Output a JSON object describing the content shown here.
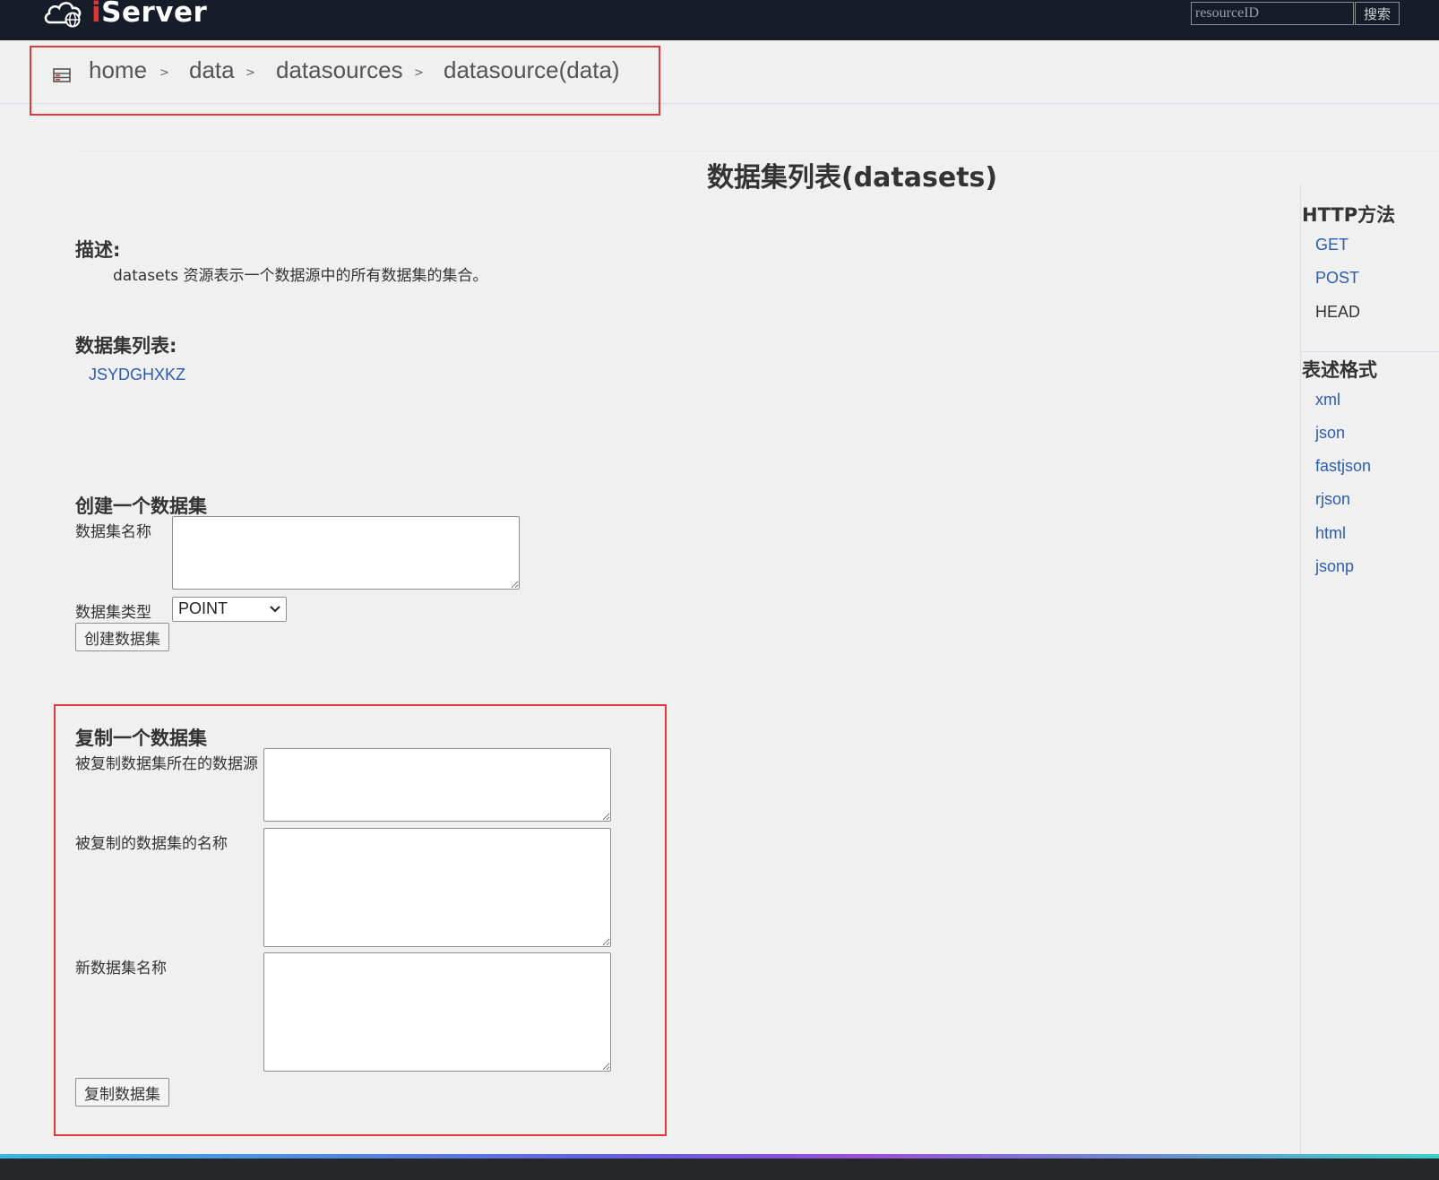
{
  "header": {
    "logo_prefix": "i",
    "logo_suffix": "Server",
    "search_placeholder": "resourceID",
    "search_button": "搜索"
  },
  "breadcrumb": [
    {
      "label": "home"
    },
    {
      "label": "data"
    },
    {
      "label": "datasources"
    },
    {
      "label": "datasource(data)"
    }
  ],
  "breadcrumb_separator": ">",
  "main": {
    "title": "数据集列表(datasets)",
    "description_heading": "描述:",
    "description_text": "datasets 资源表示一个数据源中的所有数据集的集合。",
    "list_heading": "数据集列表:",
    "datasets": [
      "JSYDGHXKZ"
    ],
    "create": {
      "heading": "创建一个数据集",
      "name_label": "数据集名称",
      "type_label": "数据集类型",
      "type_selected": "POINT",
      "submit": "创建数据集"
    },
    "copy": {
      "heading": "复制一个数据集",
      "source_datasource_label": "被复制数据集所在的数据源",
      "source_dataset_label": "被复制的数据集的名称",
      "new_name_label": "新数据集名称",
      "submit": "复制数据集"
    }
  },
  "sidebar": {
    "http_heading": "HTTP方法",
    "http_methods": [
      {
        "label": "GET",
        "link": true
      },
      {
        "label": "POST",
        "link": true
      },
      {
        "label": "HEAD",
        "link": false
      }
    ],
    "format_heading": "表述格式",
    "formats": [
      "xml",
      "json",
      "fastjson",
      "rjson",
      "html",
      "jsonp"
    ]
  },
  "colors": {
    "topbar": "#161d29",
    "highlight_border": "#e2383a",
    "link": "#2a5db0",
    "page_bg": "#f0f0f0"
  },
  "icons": {
    "logo": "cloud-globe-icon",
    "breadcrumb": "server-list-icon",
    "select": "chevron-down-icon"
  }
}
